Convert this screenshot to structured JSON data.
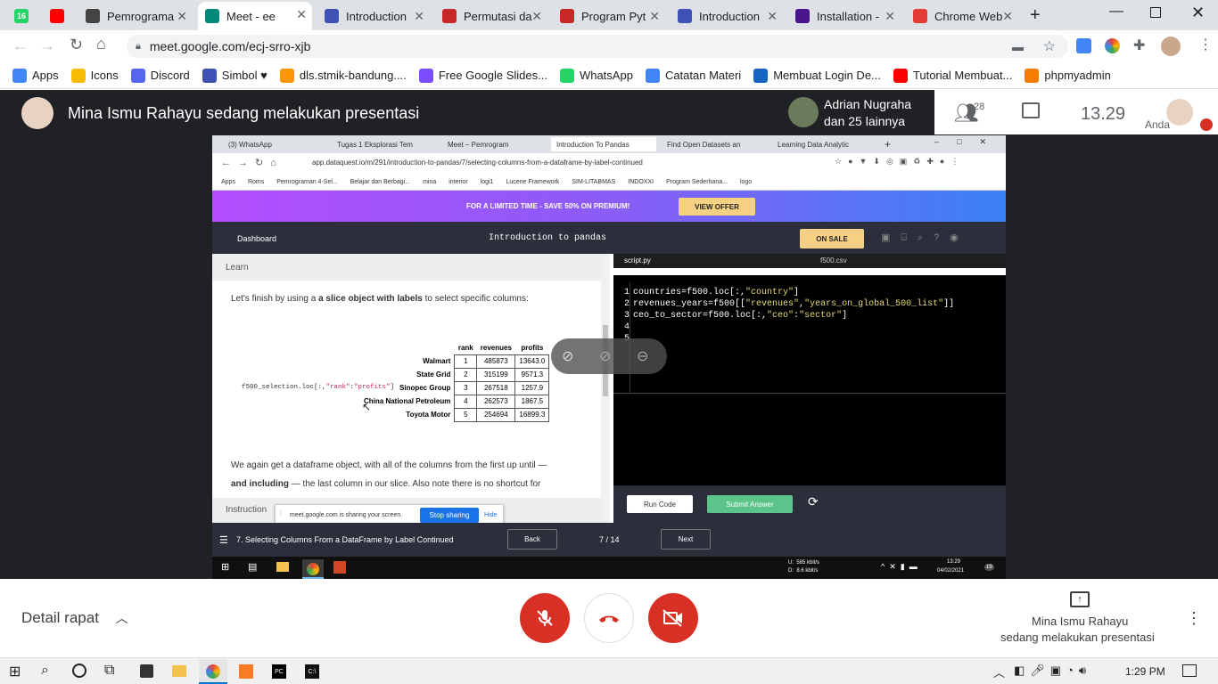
{
  "browser": {
    "tabs": [
      {
        "label": "",
        "color": "#25d366",
        "badge": "16"
      },
      {
        "label": "",
        "color": "#ff0000",
        "badge": ""
      },
      {
        "label": "Pemrograma",
        "color": "#444",
        "badge": ""
      },
      {
        "label": "Meet - ee",
        "color": "#00897b",
        "badge": ""
      },
      {
        "label": "Introduction",
        "color": "#3f51b5",
        "badge": ""
      },
      {
        "label": "Permutasi da",
        "color": "#c62828",
        "badge": ""
      },
      {
        "label": "Program Pyt",
        "color": "#c62828",
        "badge": ""
      },
      {
        "label": "Introduction",
        "color": "#3f51b5",
        "badge": ""
      },
      {
        "label": "Installation -",
        "color": "#4a148c",
        "badge": ""
      },
      {
        "label": "Chrome Web",
        "color": "#e53935",
        "badge": ""
      }
    ],
    "url": "meet.google.com/ecj-srro-xjb",
    "bookmarks": [
      {
        "label": "Apps",
        "color": "#4285f4"
      },
      {
        "label": "Icons",
        "color": "#fbbc04"
      },
      {
        "label": "Discord",
        "color": "#5865f2"
      },
      {
        "label": "Simbol ♥",
        "color": "#3f51b5"
      },
      {
        "label": "dls.stmik-bandung....",
        "color": "#ff9800"
      },
      {
        "label": "Free Google Slides...",
        "color": "#7c4dff"
      },
      {
        "label": "WhatsApp",
        "color": "#25d366"
      },
      {
        "label": "Catatan Materi",
        "color": "#4285f4"
      },
      {
        "label": "Membuat Login De...",
        "color": "#1565c0"
      },
      {
        "label": "Tutorial Membuat...",
        "color": "#ff0000"
      },
      {
        "label": "phpmyadmin",
        "color": "#f57c00"
      }
    ]
  },
  "meet": {
    "presenter_text": "Mina Ismu Rahayu sedang melakukan presentasi",
    "participant_name": "Adrian Nugraha",
    "participant_others": "dan 25 lainnya",
    "people_count": "28",
    "time": "13.29",
    "self_label": "Anda",
    "details_label": "Detail rapat",
    "presenting_line1": "Mina Ismu Rahayu",
    "presenting_line2": "sedang melakukan presentasi"
  },
  "shared": {
    "tabs": [
      "(3) WhatsApp",
      "Tugas 1 Eksplorasi Tem",
      "Meet – Pemrogram",
      "Introduction To Pandas",
      "Find Open Datasets an",
      "Learning Data Analytic"
    ],
    "url": "app.dataquest.io/m/291/introduction-to-pandas/7/selecting-columns-from-a-dataframe-by-label-continued",
    "bookmarks": [
      "Apps",
      "Roms",
      "Pemrograman 4-Sel...",
      "Belajar dan Berbagi...",
      "mina",
      "interior",
      "logi1",
      "Lucene Framework",
      "SIM-LITABMAS",
      "INDOXXI",
      "Program Sederhana...",
      "logo"
    ],
    "banner_text": "FOR A LIMITED TIME - SAVE 50% ON PREMIUM!",
    "banner_button": "VIEW OFFER",
    "dashboard": "Dashboard",
    "course_title": "Introduction to pandas",
    "on_sale": "ON SALE",
    "learn_label": "Learn",
    "intro_pre": "Let's finish by using a ",
    "intro_bold": "a slice object with labels",
    "intro_post": " to select specific columns:",
    "code_snippet": "f500_selection.loc[:,\"rank\":\"profits\"]",
    "table_headers": [
      "rank",
      "revenues",
      "profits"
    ],
    "table_rows": [
      {
        "name": "Walmart",
        "rank": "1",
        "revenues": "485873",
        "profits": "13643.0"
      },
      {
        "name": "State Grid",
        "rank": "2",
        "revenues": "315199",
        "profits": "9571.3"
      },
      {
        "name": "Sinopec Group",
        "rank": "3",
        "revenues": "267518",
        "profits": "1257.9"
      },
      {
        "name": "China National Petroleum",
        "rank": "4",
        "revenues": "262573",
        "profits": "1867.5"
      },
      {
        "name": "Toyota Motor",
        "rank": "5",
        "revenues": "254694",
        "profits": "16899.3"
      }
    ],
    "para_line1": "We again get a dataframe object, with all of the columns from the first up until —",
    "para_bold": "and including",
    "para_line2": " — the last column in our slice. Also note there is no shortcut for",
    "instructions_label": "Instruction",
    "sharing_text": "meet.google.com is sharing your screen.",
    "stop_sharing": "Stop sharing",
    "hide": "Hide",
    "editor_tabs": [
      "script.py",
      "f500.csv"
    ],
    "code_lines": [
      {
        "num": "1",
        "text": "countries=f500.loc[:,\"country\"]"
      },
      {
        "num": "2",
        "text": "revenues_years=f500[[\"revenues\",\"years_on_global_500_list\"]]"
      },
      {
        "num": "3",
        "text": "ceo_to_sector=f500.loc[:,\"ceo\":\"sector\"]"
      },
      {
        "num": "4",
        "text": ""
      },
      {
        "num": "5",
        "text": ""
      }
    ],
    "run_code": "Run Code",
    "submit_answer": "Submit Answer",
    "lesson_title": "7. Selecting Columns From a DataFrame by Label Continued",
    "back": "Back",
    "progress": "7 / 14",
    "next": "Next",
    "net_up": "585 kbit/s",
    "net_down": "8.6 kbit/s",
    "net_up_label": "U:",
    "net_down_label": "D:",
    "clock_time": "13:29",
    "clock_date": "04/02/2021",
    "notif_count": "19"
  },
  "taskbar": {
    "time": "1:29 PM"
  }
}
